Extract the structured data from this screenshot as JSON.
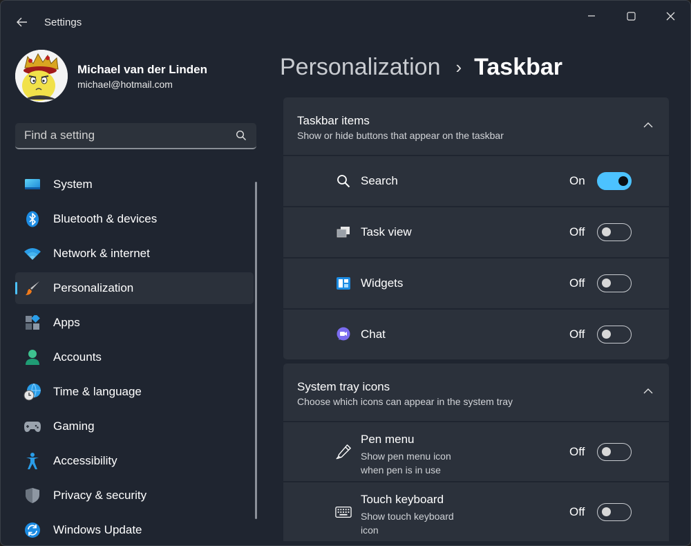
{
  "window": {
    "title": "Settings"
  },
  "profile": {
    "name": "Michael van der Linden",
    "email": "michael@hotmail.com"
  },
  "search": {
    "placeholder": "Find a setting"
  },
  "nav": {
    "items": [
      {
        "label": "System",
        "icon": "system-icon"
      },
      {
        "label": "Bluetooth & devices",
        "icon": "bluetooth-icon"
      },
      {
        "label": "Network & internet",
        "icon": "wifi-icon"
      },
      {
        "label": "Personalization",
        "icon": "brush-icon",
        "active": true
      },
      {
        "label": "Apps",
        "icon": "apps-icon"
      },
      {
        "label": "Accounts",
        "icon": "accounts-icon"
      },
      {
        "label": "Time & language",
        "icon": "time-language-icon"
      },
      {
        "label": "Gaming",
        "icon": "gamepad-icon"
      },
      {
        "label": "Accessibility",
        "icon": "accessibility-icon"
      },
      {
        "label": "Privacy & security",
        "icon": "shield-icon"
      },
      {
        "label": "Windows Update",
        "icon": "update-icon"
      }
    ]
  },
  "breadcrumb": {
    "parent": "Personalization",
    "separator": "›",
    "current": "Taskbar"
  },
  "taskbar_items": {
    "title": "Taskbar items",
    "subtitle": "Show or hide buttons that appear on the taskbar",
    "items": [
      {
        "label": "Search",
        "state": "On",
        "enabled": true,
        "icon": "search-icon"
      },
      {
        "label": "Task view",
        "state": "Off",
        "enabled": false,
        "icon": "task-view-icon"
      },
      {
        "label": "Widgets",
        "state": "Off",
        "enabled": false,
        "icon": "widgets-icon"
      },
      {
        "label": "Chat",
        "state": "Off",
        "enabled": false,
        "icon": "chat-icon"
      }
    ]
  },
  "system_tray": {
    "title": "System tray icons",
    "subtitle": "Choose which icons can appear in the system tray",
    "items": [
      {
        "label": "Pen menu",
        "description_line1": "Show pen menu icon",
        "description_line2": "when pen is in use",
        "state": "Off",
        "enabled": false,
        "icon": "pen-icon"
      },
      {
        "label": "Touch keyboard",
        "description_line1": "Show touch keyboard",
        "description_line2": "icon",
        "state": "Off",
        "enabled": false,
        "icon": "keyboard-icon"
      }
    ]
  },
  "colors": {
    "accent": "#4cc2ff",
    "background": "#1f2530",
    "card": "#2b313b"
  }
}
